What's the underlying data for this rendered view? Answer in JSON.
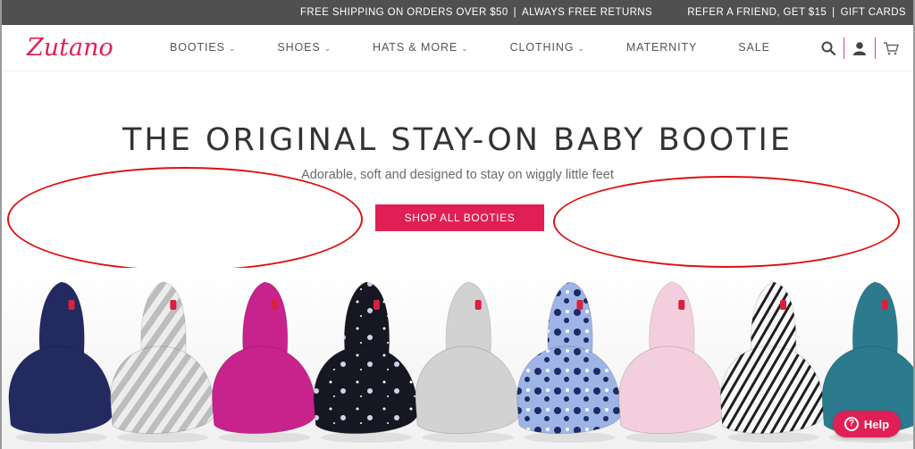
{
  "promo": {
    "shipping": "FREE SHIPPING ON ORDERS OVER $50",
    "returns": "ALWAYS FREE RETURNS",
    "separator": "|",
    "refer": "REFER A FRIEND, GET $15",
    "gift_cards": "GIFT CARDS"
  },
  "brand": {
    "logo_text": "Zutano",
    "accent": "#e01f55"
  },
  "nav": {
    "items": [
      {
        "label": "BOOTIES",
        "chev": "⌄"
      },
      {
        "label": "SHOES",
        "chev": "⌄"
      },
      {
        "label": "HATS & MORE",
        "chev": "⌄"
      },
      {
        "label": "CLOTHING",
        "chev": "⌄"
      },
      {
        "label": "MATERNITY",
        "chev": ""
      },
      {
        "label": "SALE",
        "chev": ""
      }
    ]
  },
  "header_icons": [
    "search-icon",
    "account-icon",
    "cart-icon"
  ],
  "hero": {
    "title": "THE ORIGINAL STAY-ON BABY BOOTIE",
    "subtitle": "Adorable, soft and designed to stay on wiggly little feet",
    "button": "SHOP ALL BOOTIES"
  },
  "booties": [
    {
      "color": "#232a60",
      "pattern": "solid"
    },
    {
      "color": "#dcdcdc",
      "pattern": "stripes-gray"
    },
    {
      "color": "#c8228d",
      "pattern": "solid"
    },
    {
      "color": "#161722",
      "pattern": "space"
    },
    {
      "color": "#d2d2d2",
      "pattern": "solid"
    },
    {
      "color": "#9fb4e6",
      "pattern": "dots"
    },
    {
      "color": "#f3cfdd",
      "pattern": "solid"
    },
    {
      "color": "#f6f6f6",
      "pattern": "stripes-black"
    },
    {
      "color": "#2b7a8e",
      "pattern": "solid"
    }
  ],
  "help": {
    "label": "Help",
    "icon": "?"
  }
}
